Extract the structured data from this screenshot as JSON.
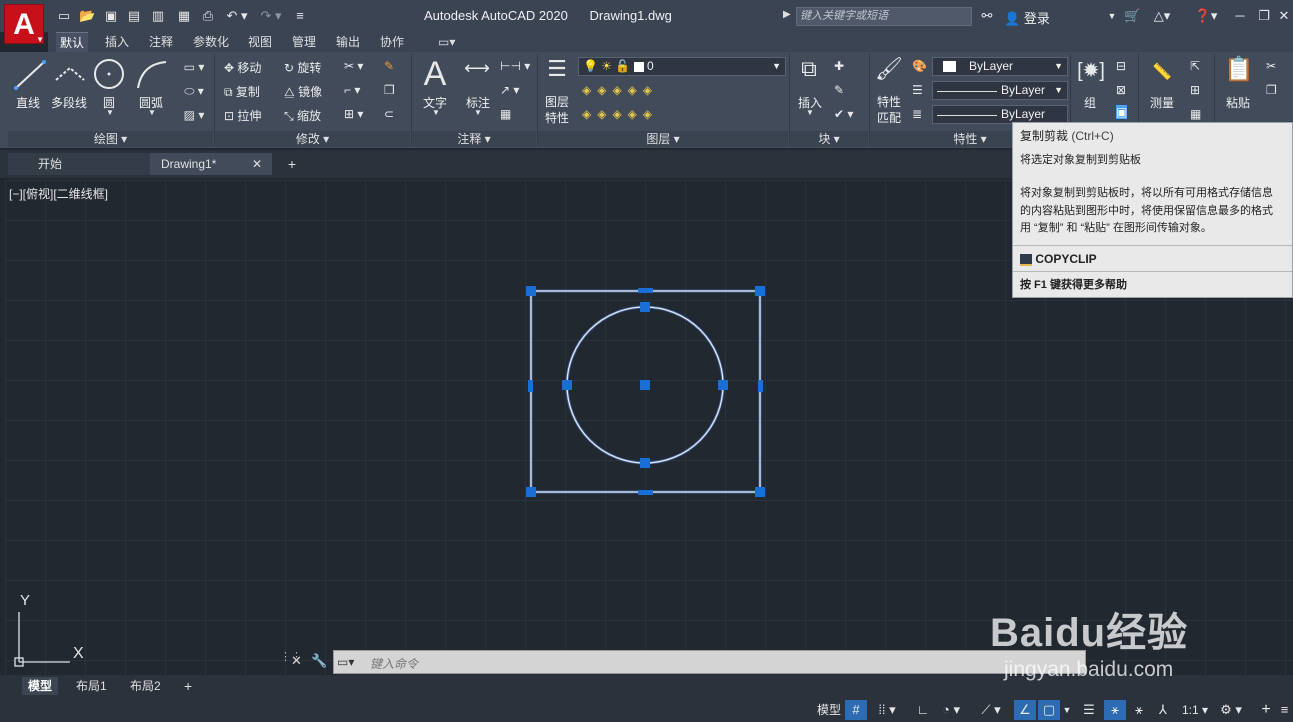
{
  "title_bar": {
    "app_title": "Autodesk AutoCAD 2020",
    "file_name": "Drawing1.dwg",
    "search_placeholder": "键入关键字或短语",
    "login_label": "登录",
    "logo_letter": "A"
  },
  "ribbon_tabs": [
    "默认",
    "插入",
    "注释",
    "参数化",
    "视图",
    "管理",
    "输出",
    "协作"
  ],
  "panels": {
    "draw": {
      "label": "绘图",
      "line": "直线",
      "polyline": "多段线",
      "circle": "圆",
      "arc": "圆弧"
    },
    "modify": {
      "label": "修改",
      "move": "移动",
      "rotate": "旋转",
      "copy": "复制",
      "mirror": "镜像",
      "stretch": "拉伸",
      "scale": "缩放"
    },
    "annotation": {
      "label": "注释",
      "text": "文字",
      "dimension": "标注"
    },
    "layers": {
      "label": "图层",
      "layer_properties": "图层\n特性",
      "layer_properties_1": "图层",
      "layer_properties_2": "特性",
      "current_layer": "0"
    },
    "block": {
      "label": "块",
      "insert": "插入"
    },
    "properties": {
      "label": "特性",
      "match_1": "特性",
      "match_2": "匹配",
      "color": "ByLayer",
      "linetype": "ByLayer",
      "lineweight": "ByLayer"
    },
    "groups": {
      "group": "组"
    },
    "utilities": {
      "measure": "测量"
    },
    "clipboard": {
      "paste": "粘贴"
    }
  },
  "doc_tabs": {
    "start": "开始",
    "drawing": "Drawing1*"
  },
  "viewport": {
    "label": "[−][俯视][二维线框]",
    "ucs_x": "X",
    "ucs_y": "Y"
  },
  "tooltip": {
    "title": "复制剪裁",
    "shortcut": "(Ctrl+C)",
    "desc1": "将选定对象复制到剪贴板",
    "desc2": "将对象复制到剪贴板时，将以所有可用格式存储信息",
    "desc3": "的内容粘贴到图形中时，将使用保留信息最多的格式",
    "desc4": "用 “复制” 和 “粘贴” 在图形间传输对象。",
    "command": "COPYCLIP",
    "help": "按 F1 键获得更多帮助"
  },
  "command_line": {
    "placeholder": "键入命令"
  },
  "layout_tabs": [
    "模型",
    "布局1",
    "布局2"
  ],
  "status_bar": {
    "model": "模型",
    "scale": "1:1"
  },
  "watermark": {
    "brand": "Baidu经验",
    "url": "jingyan.baidu.com"
  },
  "colors": {
    "selection_blue": "#1a6fd6",
    "geometry": "#dfe8f5",
    "logo_red": "#c8101a"
  }
}
